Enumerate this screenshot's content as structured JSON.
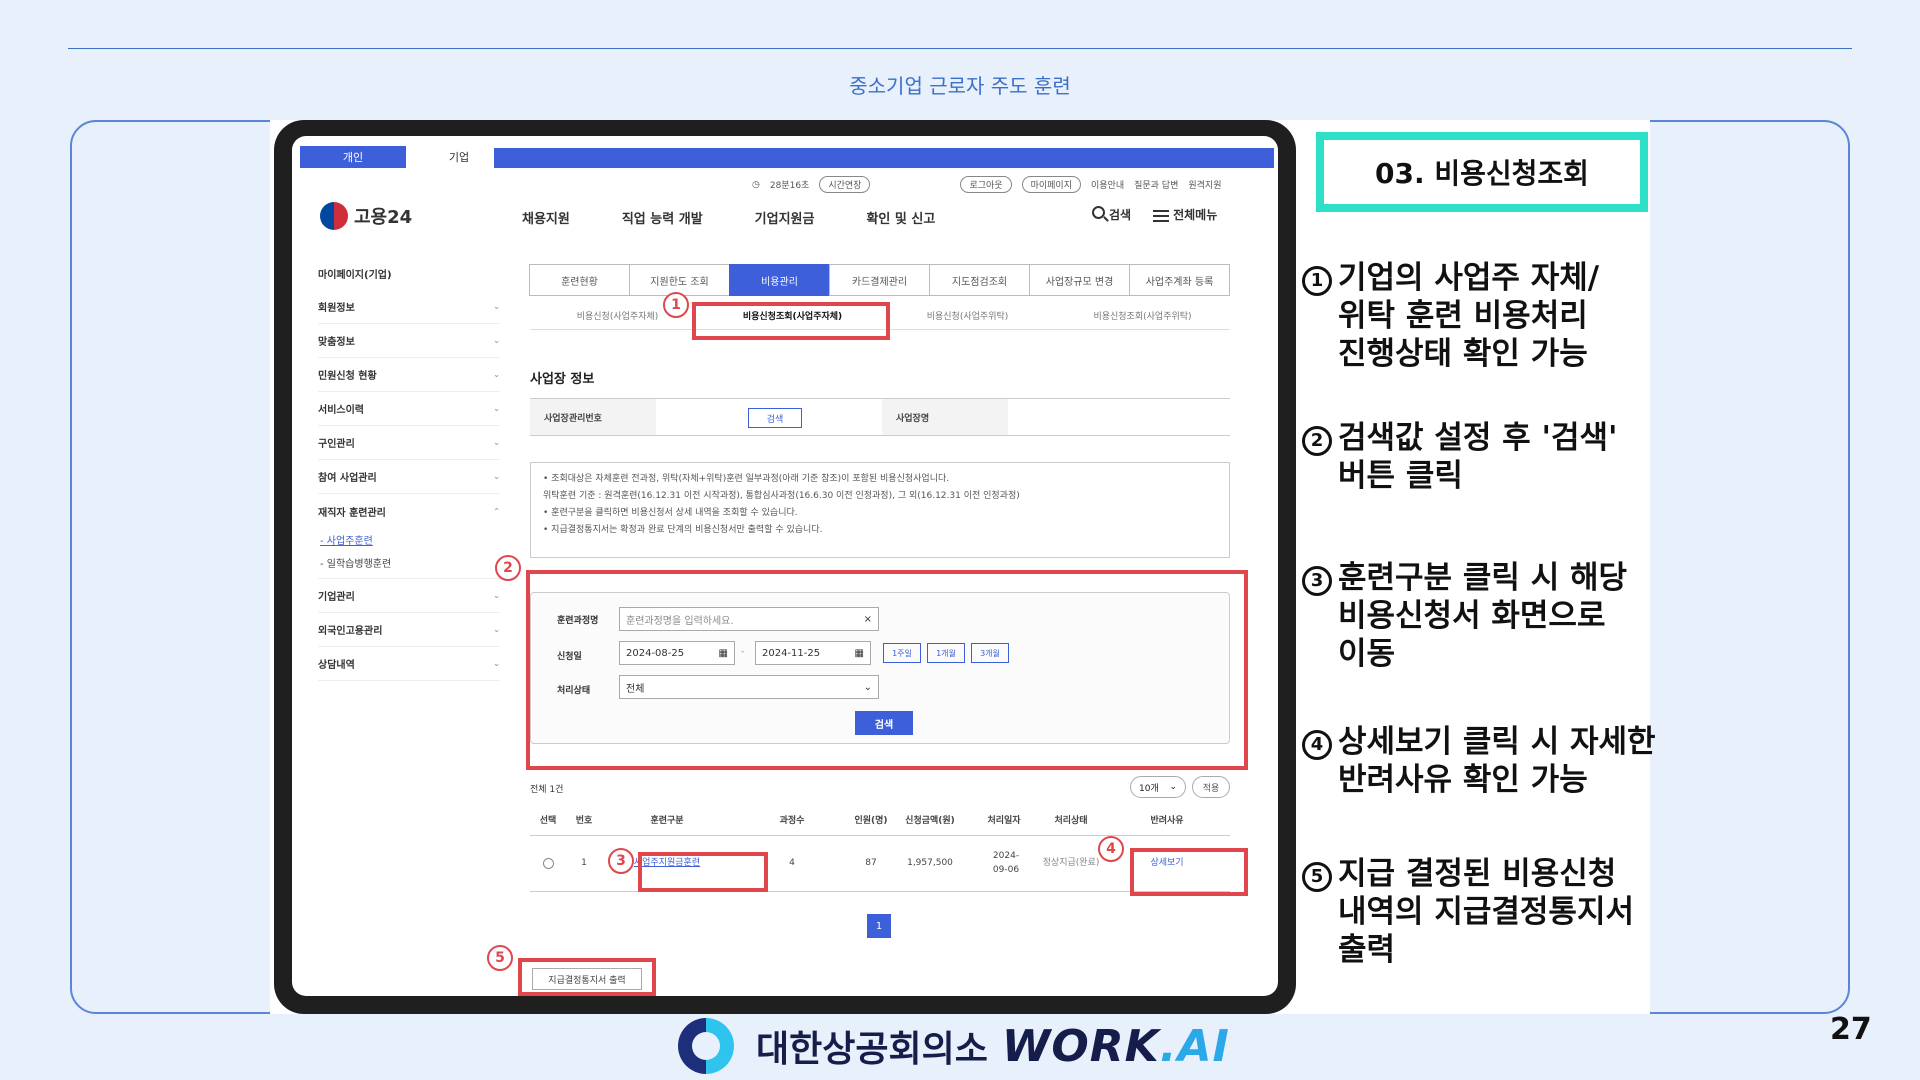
{
  "slide": {
    "title": "중소기업 근로자 주도 훈련",
    "page_number": "27",
    "section_heading": "03. 비용신청조회",
    "footer_org": "대한상공회의소",
    "footer_brand_main": "WORK",
    "footer_brand_suffix": ".AI"
  },
  "site": {
    "top_tabs": [
      "개인",
      "기업"
    ],
    "utility": {
      "timer": "28분16초",
      "extend": "시간연장",
      "logout": "로그아웃",
      "mypage": "마이페이지",
      "guide": "이용안내",
      "faq": "질문과 답변",
      "remote": "원격지원"
    },
    "logo_text": "고용24",
    "gnb": [
      "채용지원",
      "직업 능력 개발",
      "기업지원금",
      "확인 및 신고"
    ],
    "search_label": "검색",
    "menu_label": "전체메뉴"
  },
  "sidebar": {
    "heading": "마이페이지(기업)",
    "items": [
      "회원정보",
      "맞춤정보",
      "민원신청 현황",
      "서비스이력",
      "구인관리",
      "참여 사업관리",
      "재직자 훈련관리"
    ],
    "subitems": [
      "- 사업주훈련",
      "- 일학습병행훈련"
    ],
    "items_after": [
      "기업관리",
      "외국인고용관리",
      "상담내역"
    ]
  },
  "tabs": {
    "primary": [
      "훈련현황",
      "지원한도 조회",
      "비용관리",
      "카드결제관리",
      "지도점검조회",
      "사업장규모 변경",
      "사업주계좌 등록"
    ],
    "secondary": [
      "비용신청(사업주자체)",
      "비용신청조회(사업주자체)",
      "비용신청(사업주위탁)",
      "비용신청조회(사업주위탁)"
    ]
  },
  "business_info": {
    "title": "사업장 정보",
    "reg_no_label": "사업장관리번호",
    "search_btn": "검색",
    "name_label": "사업장명"
  },
  "notice": [
    "• 조회대상은 자체훈련 전과정, 위탁(자체+위탁)훈련 일부과정(아래 기준 참조)이 포함된 비용신청사업니다.",
    "  위탁훈련 기준 : 원격훈련(16.12.31 이전 시작과정), 통합심사과정(16.6.30 이전 인정과정), 그 외(16.12.31 이전 인정과정)",
    "• 훈련구분을 클릭하면 비용신청서 상세 내역을 조회할 수 있습니다.",
    "• 지급결정통지서는 확정과 완료 단계의 비용신청서만 출력할 수 있습니다."
  ],
  "search_form": {
    "course_label": "훈련과정명",
    "course_placeholder": "훈련과정명을 입력하세요.",
    "date_label": "신청일",
    "date_from": "2024-08-25",
    "date_to": "2024-11-25",
    "quick": [
      "1주일",
      "1개월",
      "3개월"
    ],
    "status_label": "처리상태",
    "status_value": "전체",
    "search_btn": "검색"
  },
  "results": {
    "total": "전체 1건",
    "page_size": "10개",
    "apply": "적용",
    "columns": [
      "선택",
      "번호",
      "훈련구분",
      "과정수",
      "인원(명)",
      "신청금액(원)",
      "처리일자",
      "처리상태",
      "반려사유"
    ],
    "row": {
      "no": "1",
      "type": "사업주지원금훈련",
      "courses": "4",
      "people": "87",
      "amount": "1,957,500",
      "date": "2024-09-06",
      "status": "정상지급(완료)",
      "reject": "상세보기"
    },
    "page": "1",
    "print_btn": "지급결정통지서 출력"
  },
  "annotations": [
    "1",
    "2",
    "3",
    "4",
    "5"
  ],
  "steps": [
    {
      "num": "1",
      "text": "기업의 사업주 자체/\n위탁 훈련 비용처리\n진행상태 확인 가능"
    },
    {
      "num": "2",
      "text": "검색값 설정 후 '검색'\n버튼 클릭"
    },
    {
      "num": "3",
      "text": "훈련구분 클릭 시 해당\n비용신청서 화면으로\n이동"
    },
    {
      "num": "4",
      "text": "상세보기 클릭 시 자세한\n반려사유 확인 가능"
    },
    {
      "num": "5",
      "text": "지급 결정된 비용신청\n내역의 지급결정통지서\n출력"
    }
  ],
  "colors": {
    "accent_blue": "#3d5fd9",
    "annotation_red": "#e0474c",
    "heading_teal": "#2ee0c8"
  }
}
